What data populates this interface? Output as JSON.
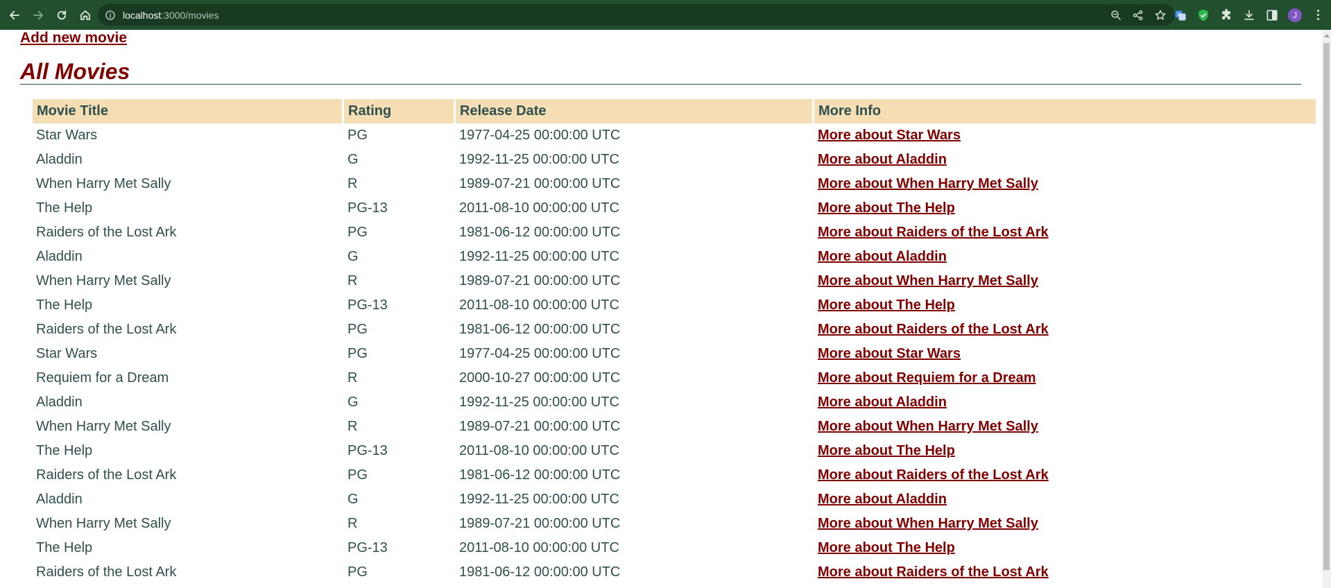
{
  "browser": {
    "url_host": "localhost",
    "url_path": ":3000/movies",
    "avatar_letter": "J",
    "accent_color": "#22502f"
  },
  "page": {
    "add_link": "Add new movie",
    "title": "All Movies",
    "text_color": "#2f4f4f",
    "link_color": "#800000",
    "header_bg": "#f5deb3"
  },
  "table": {
    "headers": [
      "Movie Title",
      "Rating",
      "Release Date",
      "More Info"
    ],
    "rows": [
      {
        "title": "Star Wars",
        "rating": "PG",
        "date": "1977-04-25 00:00:00 UTC",
        "more": "More about Star Wars"
      },
      {
        "title": "Aladdin",
        "rating": "G",
        "date": "1992-11-25 00:00:00 UTC",
        "more": "More about Aladdin"
      },
      {
        "title": "When Harry Met Sally",
        "rating": "R",
        "date": "1989-07-21 00:00:00 UTC",
        "more": "More about When Harry Met Sally"
      },
      {
        "title": "The Help",
        "rating": "PG-13",
        "date": "2011-08-10 00:00:00 UTC",
        "more": "More about The Help"
      },
      {
        "title": "Raiders of the Lost Ark",
        "rating": "PG",
        "date": "1981-06-12 00:00:00 UTC",
        "more": "More about Raiders of the Lost Ark"
      },
      {
        "title": "Aladdin",
        "rating": "G",
        "date": "1992-11-25 00:00:00 UTC",
        "more": "More about Aladdin"
      },
      {
        "title": "When Harry Met Sally",
        "rating": "R",
        "date": "1989-07-21 00:00:00 UTC",
        "more": "More about When Harry Met Sally"
      },
      {
        "title": "The Help",
        "rating": "PG-13",
        "date": "2011-08-10 00:00:00 UTC",
        "more": "More about The Help"
      },
      {
        "title": "Raiders of the Lost Ark",
        "rating": "PG",
        "date": "1981-06-12 00:00:00 UTC",
        "more": "More about Raiders of the Lost Ark"
      },
      {
        "title": "Star Wars",
        "rating": "PG",
        "date": "1977-04-25 00:00:00 UTC",
        "more": "More about Star Wars"
      },
      {
        "title": "Requiem for a Dream",
        "rating": "R",
        "date": "2000-10-27 00:00:00 UTC",
        "more": "More about Requiem for a Dream"
      },
      {
        "title": "Aladdin",
        "rating": "G",
        "date": "1992-11-25 00:00:00 UTC",
        "more": "More about Aladdin"
      },
      {
        "title": "When Harry Met Sally",
        "rating": "R",
        "date": "1989-07-21 00:00:00 UTC",
        "more": "More about When Harry Met Sally"
      },
      {
        "title": "The Help",
        "rating": "PG-13",
        "date": "2011-08-10 00:00:00 UTC",
        "more": "More about The Help"
      },
      {
        "title": "Raiders of the Lost Ark",
        "rating": "PG",
        "date": "1981-06-12 00:00:00 UTC",
        "more": "More about Raiders of the Lost Ark"
      },
      {
        "title": "Aladdin",
        "rating": "G",
        "date": "1992-11-25 00:00:00 UTC",
        "more": "More about Aladdin"
      },
      {
        "title": "When Harry Met Sally",
        "rating": "R",
        "date": "1989-07-21 00:00:00 UTC",
        "more": "More about When Harry Met Sally"
      },
      {
        "title": "The Help",
        "rating": "PG-13",
        "date": "2011-08-10 00:00:00 UTC",
        "more": "More about The Help"
      },
      {
        "title": "Raiders of the Lost Ark",
        "rating": "PG",
        "date": "1981-06-12 00:00:00 UTC",
        "more": "More about Raiders of the Lost Ark"
      }
    ]
  }
}
